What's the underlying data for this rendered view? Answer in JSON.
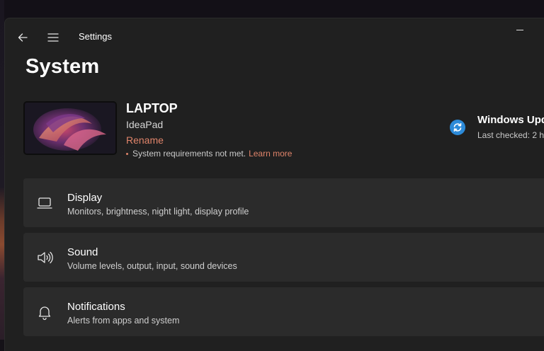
{
  "app": {
    "title": "Settings"
  },
  "page": {
    "title": "System"
  },
  "device": {
    "name": "LAPTOP",
    "model": "IdeaPad",
    "rename_label": "Rename",
    "warning_text": "System requirements not met.",
    "learn_more_label": "Learn more"
  },
  "update": {
    "title": "Windows Upd",
    "subtitle": "Last checked: 2 h",
    "icon": "sync-icon"
  },
  "settings": [
    {
      "title": "Display",
      "description": "Monitors, brightness, night light, display profile",
      "icon": "laptop-icon"
    },
    {
      "title": "Sound",
      "description": "Volume levels, output, input, sound devices",
      "icon": "speaker-icon"
    },
    {
      "title": "Notifications",
      "description": "Alerts from apps and system",
      "icon": "bell-icon"
    }
  ],
  "colors": {
    "accent_link": "#e0846a",
    "window_bg": "#202020",
    "card_bg": "#2b2b2b",
    "update_blue": "#2c8ad8"
  }
}
